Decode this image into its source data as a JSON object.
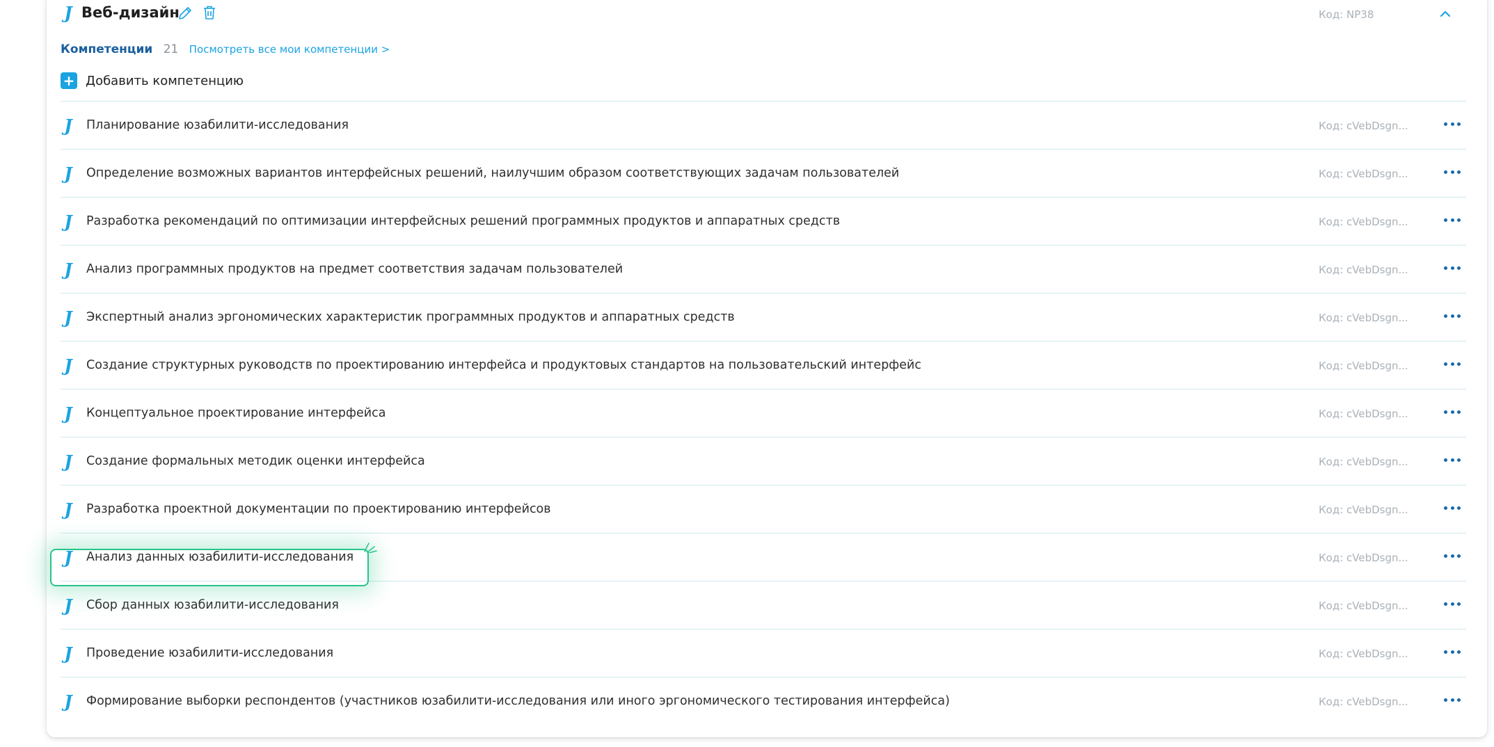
{
  "header": {
    "title": "Веб-дизайн",
    "code": "Код: NP38",
    "icons": {
      "logo": "j-icon",
      "edit": "pencil-icon",
      "delete": "trash-icon",
      "collapse": "chevron-up-icon"
    }
  },
  "competencies": {
    "label": "Компетенции",
    "count": "21",
    "view_all_link": "Посмотреть все мои компетенции >"
  },
  "add": {
    "plus": "+",
    "label": "Добавить компетенцию"
  },
  "rows": [
    {
      "text": "Планирование юзабилити-исследования",
      "code": "Код: cVebDsgn..."
    },
    {
      "text": "Определение возможных вариантов интерфейсных решений, наилучшим образом соответствующих задачам пользователей",
      "code": "Код: cVebDsgn..."
    },
    {
      "text": "Разработка рекомендаций по оптимизации интерфейсных решений программных продуктов и аппаратных средств",
      "code": "Код: cVebDsgn..."
    },
    {
      "text": "Анализ программных продуктов на предмет соответствия задачам пользователей",
      "code": "Код: cVebDsgn..."
    },
    {
      "text": "Экспертный анализ эргономических характеристик программных продуктов и аппаратных средств",
      "code": "Код: cVebDsgn..."
    },
    {
      "text": "Создание структурных руководств по проектированию интерфейса и продуктовых стандартов на пользовательский интерфейс",
      "code": "Код: cVebDsgn..."
    },
    {
      "text": "Концептуальное проектирование интерфейса",
      "code": "Код: cVebDsgn..."
    },
    {
      "text": "Создание формальных методик оценки интерфейса",
      "code": "Код: cVebDsgn..."
    },
    {
      "text": "Разработка проектной документации по проектированию интерфейсов",
      "code": "Код: cVebDsgn..."
    },
    {
      "text": "Анализ данных юзабилити-исследования",
      "code": "Код: cVebDsgn..."
    },
    {
      "text": "Сбор данных юзабилити-исследования",
      "code": "Код: cVebDsgn..."
    },
    {
      "text": "Проведение юзабилити-исследования",
      "code": "Код: cVebDsgn..."
    },
    {
      "text": "Формирование выборки респондентов (участников юзабилити-исследования или иного эргономического тестирования интерфейса)",
      "code": "Код: cVebDsgn..."
    }
  ],
  "colors": {
    "accent": "#1aa3e0",
    "highlight": "#28c48a",
    "divider": "#cfe7ef",
    "menu_dots": "#1b6aa8"
  },
  "j_glyph": "J"
}
